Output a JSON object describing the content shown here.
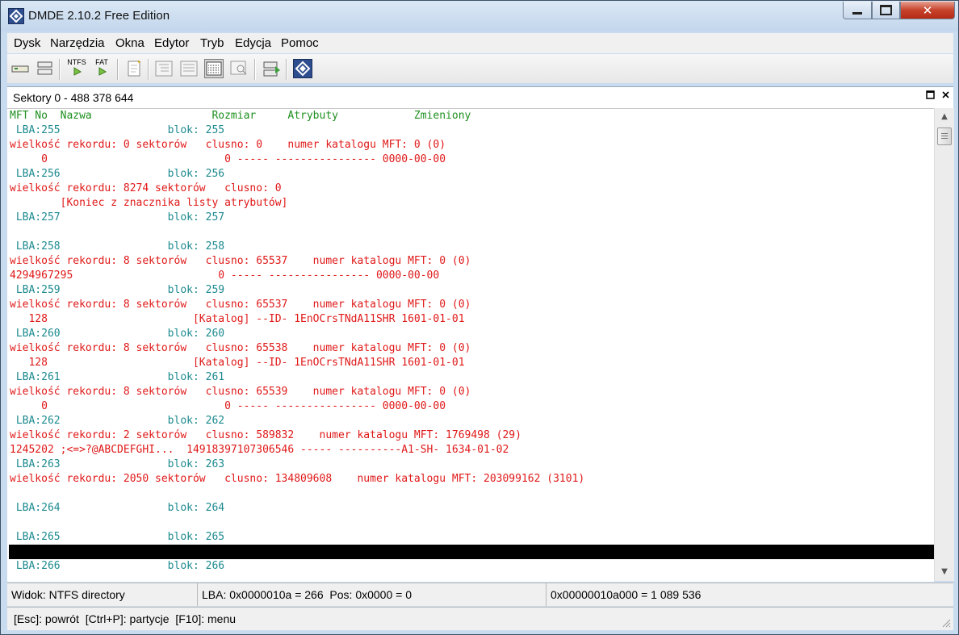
{
  "window": {
    "title": "DMDE 2.10.2 Free Edition",
    "close_label": "✕"
  },
  "menu": {
    "items": [
      "Dysk",
      "Narzędzia",
      "Okna",
      "Edytor",
      "Tryb",
      "Edycja",
      "Pomoc"
    ]
  },
  "toolbar": {
    "ntfs_label": "NTFS",
    "fat_label": "FAT"
  },
  "panel": {
    "title": "Sektory 0 - 488 378 644"
  },
  "content": {
    "header": "MFT No  Nazwa                   Rozmiar     Atrybuty            Zmieniony",
    "lines": [
      {
        "kind": "teal",
        "text": " LBA:255                 blok: 255"
      },
      {
        "kind": "red",
        "text": "wielkość rekordu: 0 sektorów   clusno: 0    numer katalogu MFT: 0 (0)"
      },
      {
        "kind": "red",
        "text": "     0                            0 ----- ---------------- 0000-00-00"
      },
      {
        "kind": "teal",
        "text": " LBA:256                 blok: 256"
      },
      {
        "kind": "red",
        "text": "wielkość rekordu: 8274 sektorów   clusno: 0"
      },
      {
        "kind": "red",
        "text": "        [Koniec z znacznika listy atrybutów]"
      },
      {
        "kind": "teal",
        "text": " LBA:257                 blok: 257"
      },
      {
        "kind": "blank",
        "text": ""
      },
      {
        "kind": "teal",
        "text": " LBA:258                 blok: 258"
      },
      {
        "kind": "red",
        "text": "wielkość rekordu: 8 sektorów   clusno: 65537    numer katalogu MFT: 0 (0)"
      },
      {
        "kind": "red",
        "text": "4294967295                       0 ----- ---------------- 0000-00-00"
      },
      {
        "kind": "teal",
        "text": " LBA:259                 blok: 259"
      },
      {
        "kind": "red",
        "text": "wielkość rekordu: 8 sektorów   clusno: 65537    numer katalogu MFT: 0 (0)"
      },
      {
        "kind": "red",
        "text": "   128                       [Katalog] --ID- 1EnOCrsTNdA11SHR 1601-01-01"
      },
      {
        "kind": "teal",
        "text": " LBA:260                 blok: 260"
      },
      {
        "kind": "red",
        "text": "wielkość rekordu: 8 sektorów   clusno: 65538    numer katalogu MFT: 0 (0)"
      },
      {
        "kind": "red",
        "text": "   128                       [Katalog] --ID- 1EnOCrsTNdA11SHR 1601-01-01"
      },
      {
        "kind": "teal",
        "text": " LBA:261                 blok: 261"
      },
      {
        "kind": "red",
        "text": "wielkość rekordu: 8 sektorów   clusno: 65539    numer katalogu MFT: 0 (0)"
      },
      {
        "kind": "red",
        "text": "     0                            0 ----- ---------------- 0000-00-00"
      },
      {
        "kind": "teal",
        "text": " LBA:262                 blok: 262"
      },
      {
        "kind": "red",
        "text": "wielkość rekordu: 2 sektorów   clusno: 589832    numer katalogu MFT: 1769498 (29)"
      },
      {
        "kind": "red",
        "text": "1245202 ;<=>?@ABCDEFGHI...  14918397107306546 ----- ----------A1-SH- 1634-01-02"
      },
      {
        "kind": "teal",
        "text": " LBA:263                 blok: 263"
      },
      {
        "kind": "red",
        "text": "wielkość rekordu: 2050 sektorów   clusno: 134809608    numer katalogu MFT: 203099162 (3101)"
      },
      {
        "kind": "blank",
        "text": ""
      },
      {
        "kind": "teal",
        "text": " LBA:264                 blok: 264"
      },
      {
        "kind": "blank",
        "text": ""
      },
      {
        "kind": "teal",
        "text": " LBA:265                 blok: 265"
      },
      {
        "kind": "selected",
        "text": ""
      },
      {
        "kind": "teal",
        "text": " LBA:266                 blok: 266"
      }
    ]
  },
  "status": {
    "view": "Widok: NTFS directory",
    "lba": "LBA: 0x0000010a = 266  Pos: 0x0000 = 0",
    "offset": "0x00000010a000 = 1 089 536",
    "hints": "[Esc]: powrót  [Ctrl+P]: partycje  [F10]: menu"
  },
  "colors": {
    "header": "#1e8f1e",
    "lba": "#1d8a8f",
    "record": "#e01818"
  }
}
